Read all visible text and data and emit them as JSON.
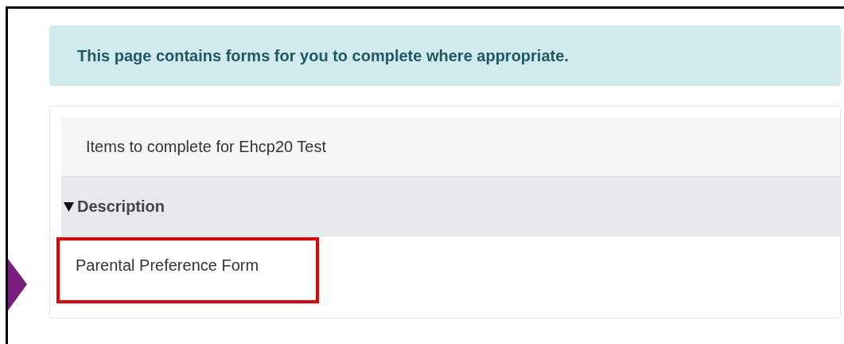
{
  "alert": {
    "text": "This page contains forms for you to complete where appropriate."
  },
  "panel": {
    "heading": "Items to complete for Ehcp20 Test",
    "section": {
      "label": "Description",
      "expanded": true
    },
    "items": [
      {
        "label": "Parental Preference Form",
        "highlighted": true
      }
    ]
  }
}
